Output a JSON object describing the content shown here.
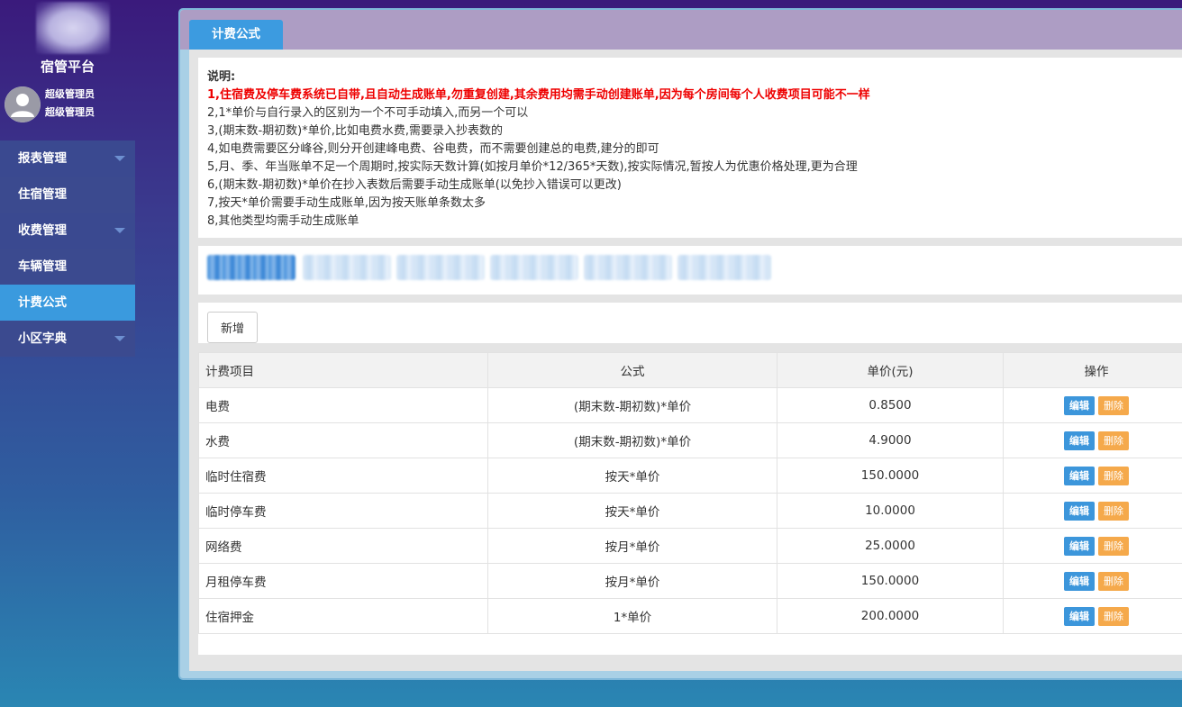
{
  "sidebar": {
    "app_title": "宿管平台",
    "user_role": "超级管理员",
    "user_name": "超级管理员",
    "menu": [
      {
        "label": "报表管理",
        "has_caret": true
      },
      {
        "label": "住宿管理",
        "has_caret": false
      },
      {
        "label": "收费管理",
        "has_caret": true
      },
      {
        "label": "车辆管理",
        "has_caret": false
      },
      {
        "label": "计费公式",
        "has_caret": false,
        "active": true
      },
      {
        "label": "小区字典",
        "has_caret": true
      }
    ]
  },
  "tab": {
    "label": "计费公式"
  },
  "notes": {
    "title": "说明:",
    "lines": [
      "1,住宿费及停车费系统已自带,且自动生成账单,勿重复创建,其余费用均需手动创建账单,因为每个房间每个人收费项目可能不一样",
      "2,1*单价与自行录入的区别为一个不可手动填入,而另一个可以",
      "3,(期末数-期初数)*单价,比如电费水费,需要录入抄表数的",
      "4,如电费需要区分峰谷,则分开创建峰电费、谷电费，而不需要创建总的电费,建分的即可",
      "5,月、季、年当账单不足一个周期时,按实际天数计算(如按月单价*12/365*天数),按实际情况,暂按人为优惠价格处理,更为合理",
      "6,(期末数-期初数)*单价在抄入表数后需要手动生成账单(以免抄入错误可以更改)",
      "7,按天*单价需要手动生成账单,因为按天账单条数太多",
      "8,其他类型均需手动生成账单"
    ]
  },
  "toolbar": {
    "add_label": "新增"
  },
  "table": {
    "headers": [
      "计费项目",
      "公式",
      "单价(元)",
      "操作"
    ],
    "edit_label": "编辑",
    "delete_label": "删除",
    "rows": [
      {
        "name": "电费",
        "formula": "(期末数-期初数)*单价",
        "price": "0.8500"
      },
      {
        "name": "水费",
        "formula": "(期末数-期初数)*单价",
        "price": "4.9000"
      },
      {
        "name": "临时住宿费",
        "formula": "按天*单价",
        "price": "150.0000"
      },
      {
        "name": "临时停车费",
        "formula": "按天*单价",
        "price": "10.0000"
      },
      {
        "name": "网络费",
        "formula": "按月*单价",
        "price": "25.0000"
      },
      {
        "name": "月租停车费",
        "formula": "按月*单价",
        "price": "150.0000"
      },
      {
        "name": "住宿押金",
        "formula": "1*单价",
        "price": "200.0000"
      }
    ]
  },
  "colors": {
    "accent": "#3c9be0",
    "delete": "#f5a94b",
    "notice_red": "#ee0000"
  }
}
